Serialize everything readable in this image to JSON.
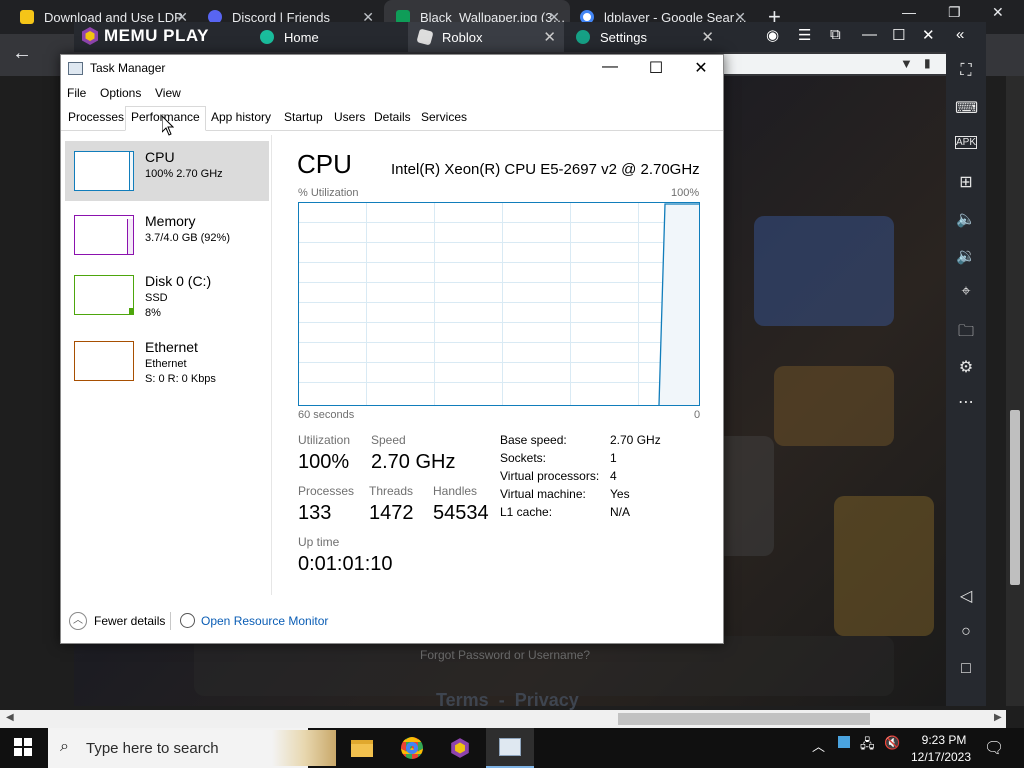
{
  "chrome": {
    "tabs": [
      {
        "title": "Download and Use LDP",
        "color": "#f5c518"
      },
      {
        "title": "Discord | Friends",
        "color": "#5865f2"
      },
      {
        "title": "Black_Wallpaper.jpg (3…",
        "color": "#0f9d58"
      },
      {
        "title": "ldplayer - Google Sear…",
        "color": "#4285f4"
      }
    ]
  },
  "memu": {
    "logo": "MEMU PLAY",
    "tabs": [
      {
        "label": "Home"
      },
      {
        "label": "Roblox"
      },
      {
        "label": "Settings"
      }
    ]
  },
  "game": {
    "forgot": "Forgot Password or Username?",
    "terms": "Terms  -  Privacy"
  },
  "taskmanager": {
    "title": "Task Manager",
    "menus": [
      "File",
      "Options",
      "View"
    ],
    "tabs": [
      "Processes",
      "Performance",
      "App history",
      "Startup",
      "Users",
      "Details",
      "Services"
    ],
    "sidebar": [
      {
        "name": "CPU",
        "line1": "100%  2.70 GHz",
        "line2": "",
        "color": "#117dbb"
      },
      {
        "name": "Memory",
        "line1": "3.7/4.0 GB (92%)",
        "line2": "",
        "color": "#8b12ae"
      },
      {
        "name": "Disk 0 (C:)",
        "line1": "SSD",
        "line2": "8%",
        "color": "#4da60c"
      },
      {
        "name": "Ethernet",
        "line1": "Ethernet",
        "line2": "S: 0  R: 0 Kbps",
        "color": "#a74f01"
      }
    ],
    "cpu": {
      "heading": "CPU",
      "model": "Intel(R) Xeon(R) CPU E5-2697 v2 @ 2.70GHz",
      "util_label": "% Utilization",
      "util_max": "100%",
      "time_left": "60 seconds",
      "time_right": "0",
      "stats": {
        "utilization_label": "Utilization",
        "utilization": "100%",
        "speed_label": "Speed",
        "speed": "2.70 GHz",
        "processes_label": "Processes",
        "processes": "133",
        "threads_label": "Threads",
        "threads": "1472",
        "handles_label": "Handles",
        "handles": "54534",
        "uptime_label": "Up time",
        "uptime": "0:01:01:10"
      },
      "details": [
        {
          "k": "Base speed:",
          "v": "2.70 GHz"
        },
        {
          "k": "Sockets:",
          "v": "1"
        },
        {
          "k": "Virtual processors:",
          "v": "4"
        },
        {
          "k": "Virtual machine:",
          "v": "Yes"
        },
        {
          "k": "L1 cache:",
          "v": "N/A"
        }
      ]
    },
    "footer": {
      "fewer": "Fewer details",
      "resmon": "Open Resource Monitor"
    }
  },
  "taskbar": {
    "search_placeholder": "Type here to search",
    "time": "9:23 PM",
    "date": "12/17/2023"
  }
}
